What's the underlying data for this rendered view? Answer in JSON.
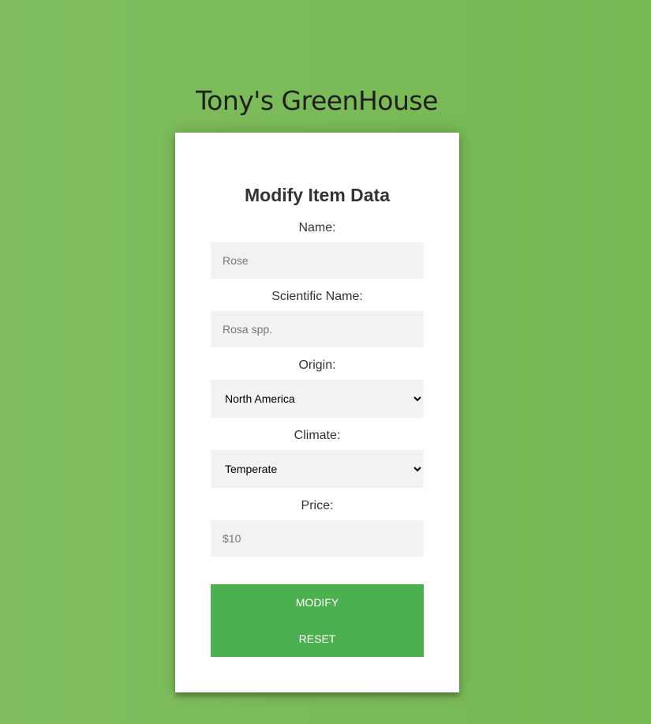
{
  "header": {
    "title": "Tony's GreenHouse"
  },
  "form": {
    "heading": "Modify Item Data",
    "name": {
      "label": "Name:",
      "placeholder": "Rose"
    },
    "scientific_name": {
      "label": "Scientific Name:",
      "placeholder": "Rosa spp."
    },
    "origin": {
      "label": "Origin:",
      "selected": "North America"
    },
    "climate": {
      "label": "Climate:",
      "selected": "Temperate"
    },
    "price": {
      "label": "Price:",
      "placeholder": "$10"
    },
    "modify_label": "MODIFY",
    "reset_label": "RESET"
  },
  "colors": {
    "background": "#76b852",
    "button": "#4caf50"
  }
}
